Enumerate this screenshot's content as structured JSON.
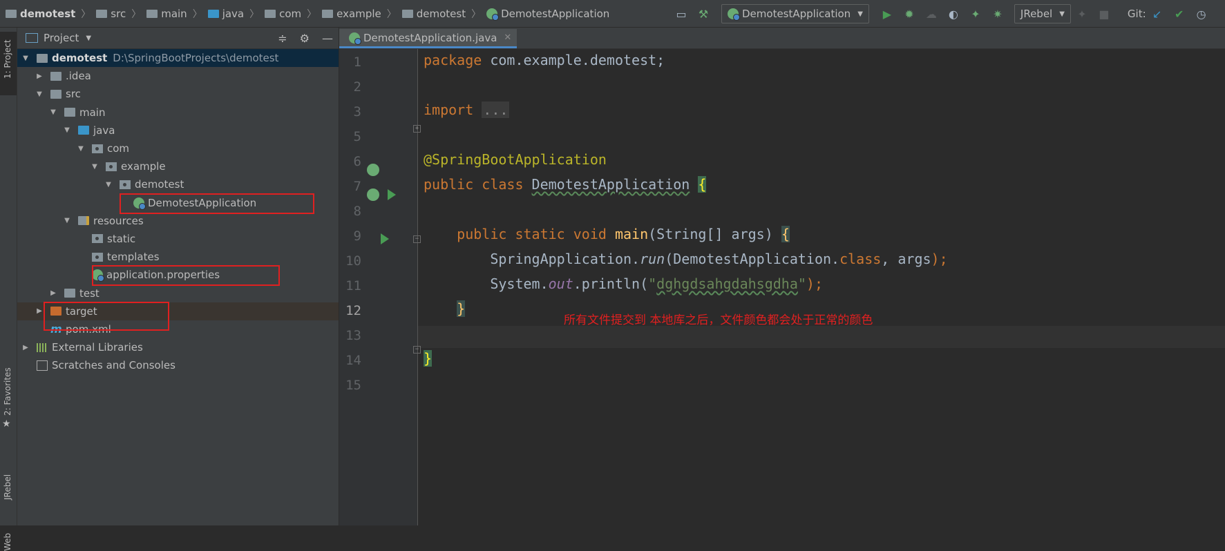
{
  "breadcrumb": {
    "items": [
      "demotest",
      "src",
      "main",
      "java",
      "com",
      "example",
      "demotest",
      "DemotestApplication"
    ]
  },
  "toolbar": {
    "run_config": "DemotestApplication",
    "jrebel": "JRebel",
    "git_label": "Git:",
    "icons": [
      "build-icon",
      "hammer-icon",
      "run-icon",
      "debug-icon",
      "coverage-icon",
      "profile-icon",
      "jrebel-run-icon",
      "jrebel-debug-icon",
      "stop-icon",
      "git-update-icon",
      "git-commit-icon",
      "history-icon"
    ]
  },
  "left_strip": {
    "project_label": "1: Project",
    "favorites_label": "2: Favorites",
    "jrebel_label": "JRebel",
    "web_label": "Web"
  },
  "project": {
    "title": "Project",
    "root_name": "demotest",
    "root_path": "D:\\SpringBootProjects\\demotest",
    "tree": {
      "idea": ".idea",
      "src": "src",
      "main": "main",
      "java": "java",
      "com": "com",
      "example": "example",
      "demotest": "demotest",
      "app_class": "DemotestApplication",
      "resources": "resources",
      "static": "static",
      "templates": "templates",
      "app_props": "application.properties",
      "test": "test",
      "target": "target",
      "pom": "pom.xml",
      "ext_libs": "External Libraries",
      "scratches": "Scratches and Consoles"
    }
  },
  "editor": {
    "tab_title": "DemotestApplication.java",
    "line_numbers": [
      "1",
      "2",
      "3",
      "5",
      "6",
      "7",
      "8",
      "9",
      "10",
      "11",
      "12",
      "13",
      "14",
      "15"
    ],
    "current_line": "12",
    "code": {
      "l1_kw": "package",
      "l1_rest": " com.example.demotest;",
      "l3_kw": "import",
      "l3_fold": "...",
      "l6_ann": "@SpringBootApplication",
      "l7_kw": "public class",
      "l7_name": "DemotestApplication",
      "l7_brace": "{",
      "l9_kw": "public static void",
      "l9_fn": "main",
      "l9_rest": "(String[] args)",
      "l9_brace": "{",
      "l10_a": "SpringApplication.",
      "l10_run": "run",
      "l10_b": "(DemotestApplication.",
      "l10_kw": "class",
      "l10_c": ", args",
      "l10_d": ");",
      "l11_a": "System.",
      "l11_out": "out",
      "l11_b": ".println(",
      "l11_str_q1": "\"",
      "l11_str": "dghgdsahgdahsgdha",
      "l11_str_q2": "\"",
      "l11_c": ");",
      "l12_brace": "}",
      "l14_brace": "}"
    },
    "annotation_note": "所有文件提交到   本地库之后，文件颜色都会处于正常的颜色"
  }
}
